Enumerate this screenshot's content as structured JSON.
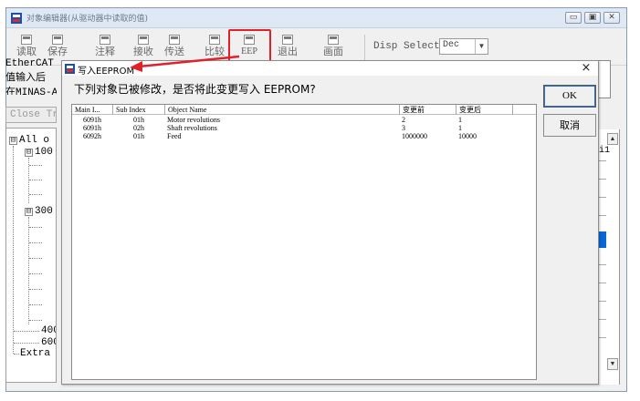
{
  "window": {
    "title": "对象编辑器(从驱动器中读取的值)",
    "controls": [
      "▭",
      "▣",
      "✕"
    ]
  },
  "toolbar": {
    "buttons": [
      {
        "label": "读取",
        "icon": "save-icon"
      },
      {
        "label": "保存",
        "icon": "save-icon"
      },
      {
        "label": "注释",
        "icon": "note-icon"
      },
      {
        "label": "接收",
        "icon": "receive-icon"
      },
      {
        "label": "传送",
        "icon": "send-icon"
      },
      {
        "label": "比较",
        "icon": "compare-icon"
      },
      {
        "label": "EEP",
        "icon": "eeprom-icon"
      },
      {
        "label": "退出",
        "icon": "exit-icon"
      },
      {
        "label": "画面",
        "icon": "screen-icon"
      }
    ],
    "disp_select_label": "Disp Select",
    "disp_select_value": "Dec",
    "highlight_color": "#e3202a"
  },
  "background": {
    "info_lines": [
      "EtherCAT",
      "值输入后",
      "在MINAS-A"
    ],
    "close_tree_label": "Close Tr",
    "tree": [
      {
        "label": "All o",
        "level": 0,
        "expander": "⊟"
      },
      {
        "label": "100",
        "level": 1,
        "expander": "⊟"
      },
      {
        "label": "300",
        "level": 1,
        "expander": "⊟"
      },
      {
        "label": "400",
        "level": 1,
        "expander": ""
      },
      {
        "label": "600",
        "level": 1,
        "expander": ""
      },
      {
        "label": "Extra",
        "level": 0,
        "expander": ""
      }
    ],
    "right_label": "i1"
  },
  "dialog": {
    "title": "写入EEPROM",
    "close_glyph": "×",
    "message": "下列对象已被修改，是否将此变更写入 EEPROM?",
    "ok_label": "OK",
    "cancel_label": "取消",
    "columns": [
      "Main I...",
      "Sub Index",
      "Object Name",
      "变更前",
      "变更后"
    ],
    "rows": [
      {
        "main": "6091h",
        "sub": "01h",
        "name": "Motor revolutions",
        "before": "2",
        "after": "1"
      },
      {
        "main": "6091h",
        "sub": "02h",
        "name": "Shaft revolutions",
        "before": "3",
        "after": "1"
      },
      {
        "main": "6092h",
        "sub": "01h",
        "name": "Feed",
        "before": "1000000",
        "after": "10000"
      }
    ]
  },
  "colors": {
    "accent": "#e3202a",
    "selection": "#0a67d6"
  }
}
